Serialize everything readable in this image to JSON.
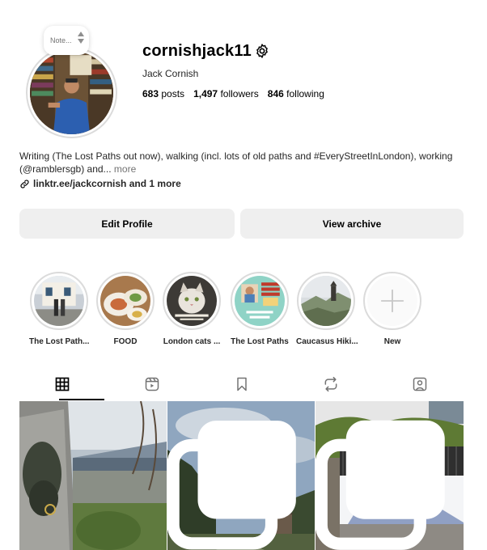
{
  "profile": {
    "note_placeholder": "Note...",
    "username": "cornishjack11",
    "full_name": "Jack Cornish",
    "stats": {
      "posts_count": "683",
      "posts_label": "posts",
      "followers_count": "1,497",
      "followers_label": "followers",
      "following_count": "846",
      "following_label": "following"
    },
    "bio_text": "Writing (The Lost Paths out now), walking (incl. lots of old paths and #EveryStreetInLondon), working (@ramblersgb) and...",
    "bio_more": "more",
    "link_text": "linktr.ee/jackcornish and 1 more"
  },
  "actions": {
    "edit_profile": "Edit Profile",
    "view_archive": "View archive"
  },
  "highlights": [
    {
      "label": "The Lost Path..."
    },
    {
      "label": "FOOD"
    },
    {
      "label": "London cats ..."
    },
    {
      "label": "The Lost Paths"
    },
    {
      "label": "Caucasus Hiki..."
    },
    {
      "label": "New"
    }
  ],
  "tabs": [
    "grid-icon",
    "reels-icon",
    "saved-icon",
    "reposts-icon",
    "tagged-icon"
  ],
  "posts": [
    {
      "type": "photo"
    },
    {
      "type": "carousel"
    },
    {
      "type": "carousel"
    }
  ]
}
